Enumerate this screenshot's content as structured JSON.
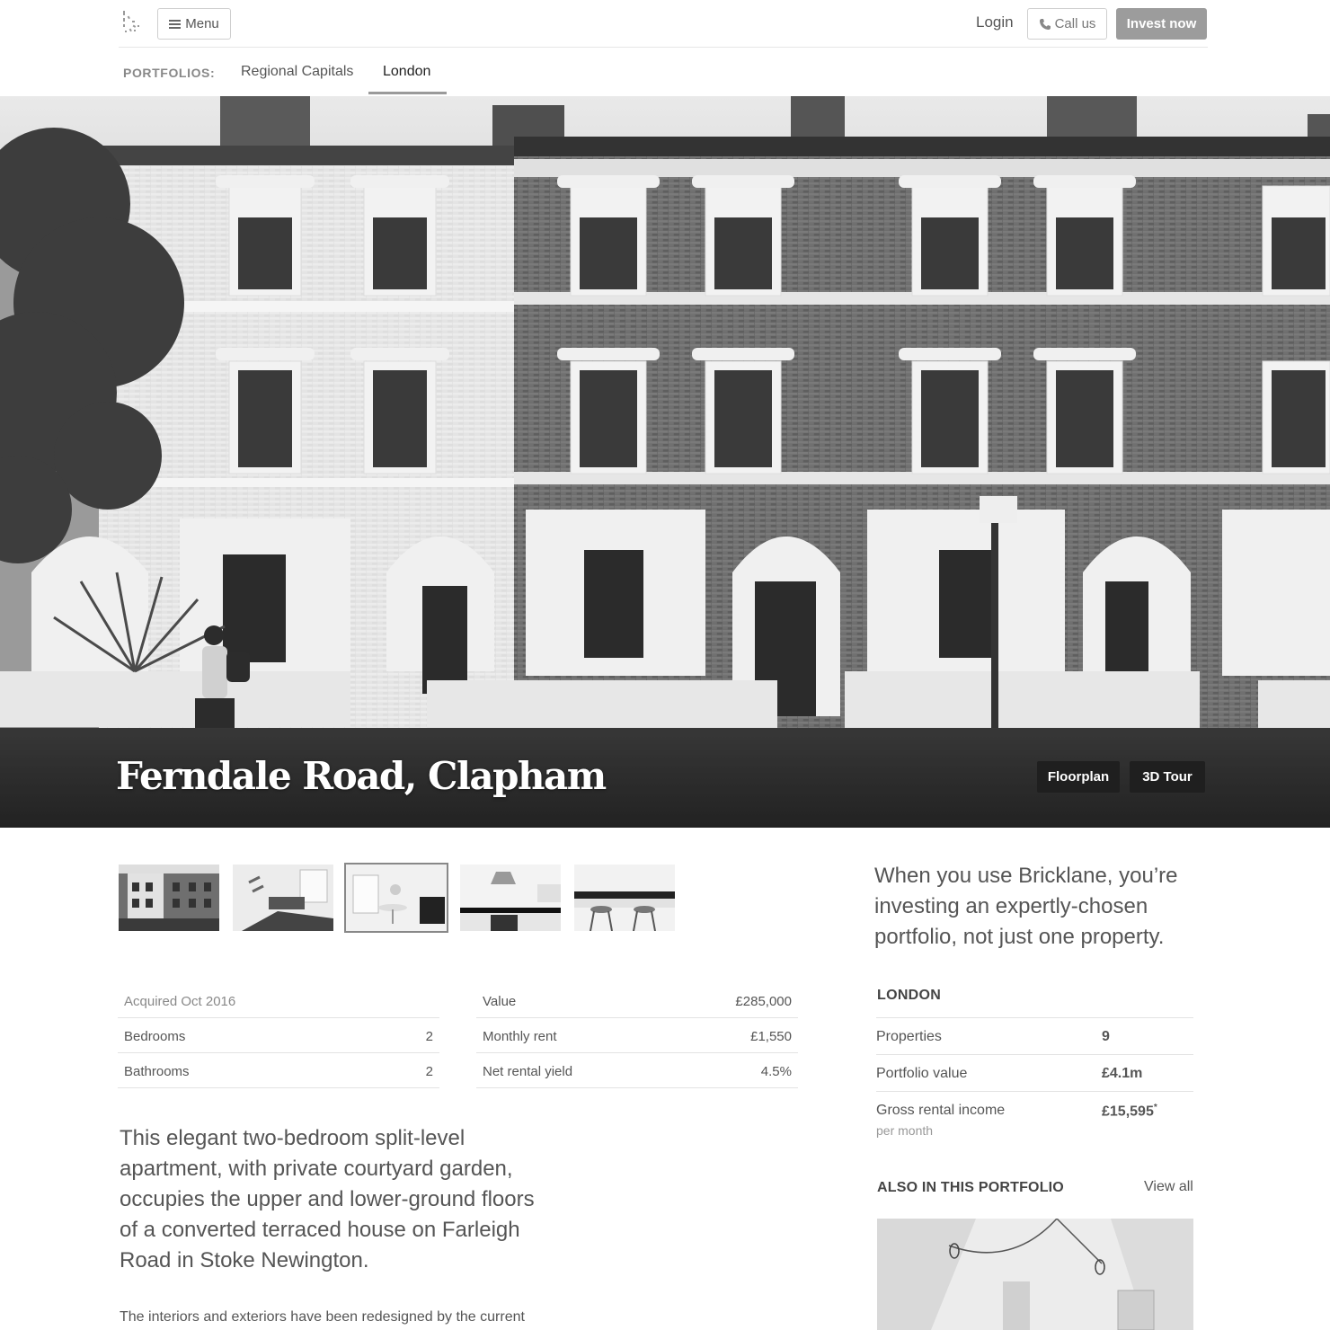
{
  "header": {
    "menu_label": "Menu",
    "login_label": "Login",
    "call_label": "Call us",
    "invest_label": "Invest now"
  },
  "subnav": {
    "label": "PORTFOLIOS:",
    "tabs": [
      {
        "label": "Regional Capitals",
        "active": false
      },
      {
        "label": "London",
        "active": true
      }
    ]
  },
  "hero": {
    "title": "Ferndale Road, Clapham",
    "buttons": {
      "floorplan": "Floorplan",
      "tour": "3D Tour"
    }
  },
  "gallery": {
    "thumbnails": [
      {
        "subject": "street exterior"
      },
      {
        "subject": "living room"
      },
      {
        "subject": "dining area",
        "active": true
      },
      {
        "subject": "kitchen"
      },
      {
        "subject": "breakfast bar"
      }
    ]
  },
  "property": {
    "left_table": {
      "acquired": "Acquired Oct 2016",
      "rows": [
        {
          "label": "Bedrooms",
          "value": "2"
        },
        {
          "label": "Bathrooms",
          "value": "2"
        }
      ]
    },
    "right_table": {
      "rows": [
        {
          "label": "Value",
          "value": "£285,000"
        },
        {
          "label": "Monthly rent",
          "value": "£1,550"
        },
        {
          "label": "Net rental yield",
          "value": "4.5%"
        }
      ]
    },
    "description_lead": "This elegant two-bedroom split-level apartment, with private courtyard garden, occupies the upper and lower-ground floors of a converted terraced house on Farleigh Road in Stoke Newington.",
    "description_body": "The interiors and exteriors have been redesigned by the current"
  },
  "sidebar": {
    "pitch": "When you use Bricklane, you’re investing an expertly-chosen portfolio, not just one property.",
    "portfolio_name": "LONDON",
    "stats": [
      {
        "label": "Properties",
        "value": "9"
      },
      {
        "label": "Portfolio value",
        "value": "£4.1m"
      },
      {
        "label": "Gross rental income",
        "value": "£15,595",
        "note": "*",
        "sub": "per month"
      }
    ],
    "also_heading": "ALSO IN THIS PORTFOLIO",
    "view_all": "View all"
  },
  "colors": {
    "accent_button": "#9c9c9c",
    "hero_button": "#1f1f1f",
    "text": "#555555"
  }
}
